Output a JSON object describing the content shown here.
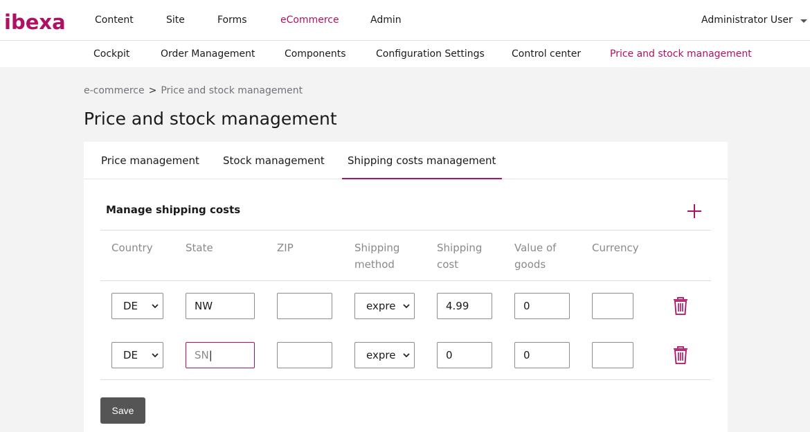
{
  "brand": {
    "logo_text": "ibexa",
    "accent": "#ae1164"
  },
  "top_nav": {
    "items": [
      {
        "label": "Content"
      },
      {
        "label": "Site"
      },
      {
        "label": "Forms"
      },
      {
        "label": "eCommerce",
        "active": true
      },
      {
        "label": "Admin"
      }
    ],
    "user": "Administrator User"
  },
  "sub_nav": {
    "items": [
      {
        "label": "Cockpit"
      },
      {
        "label": "Order Management"
      },
      {
        "label": "Components"
      },
      {
        "label": "Configuration Settings"
      },
      {
        "label": "Control center"
      },
      {
        "label": "Price and stock management",
        "active": true
      }
    ]
  },
  "breadcrumb": {
    "parent": "e-commerce",
    "separator": ">",
    "current": "Price and stock management"
  },
  "page_title": "Price and stock management",
  "tabs": [
    {
      "label": "Price management"
    },
    {
      "label": "Stock management"
    },
    {
      "label": "Shipping costs management",
      "active": true
    }
  ],
  "section_title": "Manage shipping costs",
  "columns": {
    "country": [
      "Country"
    ],
    "state": [
      "State"
    ],
    "zip": [
      "ZIP"
    ],
    "shipping_method": [
      "Shipping",
      "method"
    ],
    "shipping_cost": [
      "Shipping",
      "cost"
    ],
    "value_of_goods": [
      "Value of",
      "goods"
    ],
    "currency": [
      "Currency"
    ]
  },
  "rows": [
    {
      "country": "DE",
      "state": "NW",
      "zip": "",
      "shipping_method": "expre",
      "shipping_cost": "4.99",
      "value_of_goods": "0",
      "currency": ""
    },
    {
      "country": "DE",
      "state": "SN",
      "zip": "",
      "shipping_method": "expre",
      "shipping_cost": "0",
      "value_of_goods": "0",
      "currency": ""
    }
  ],
  "save_label": "Save"
}
